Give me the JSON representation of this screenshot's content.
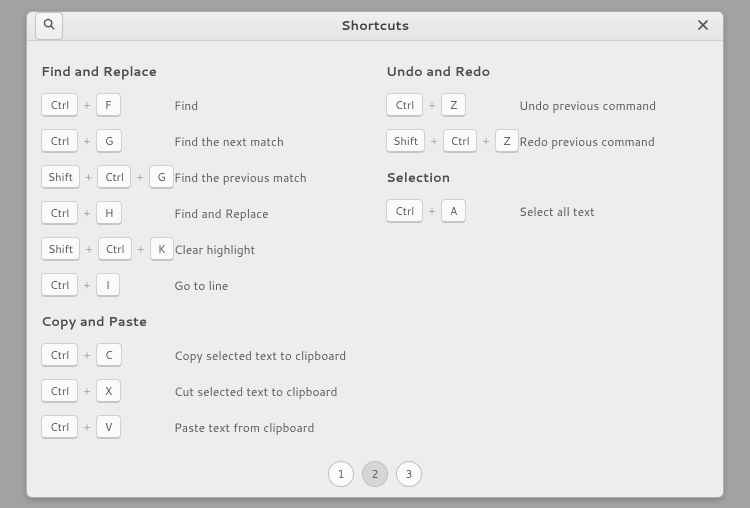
{
  "title": "Shortcuts",
  "plus": "+",
  "left": {
    "sections": [
      {
        "title": "Find and Replace",
        "rows": [
          {
            "keys": [
              "Ctrl",
              "F"
            ],
            "desc": "Find"
          },
          {
            "keys": [
              "Ctrl",
              "G"
            ],
            "desc": "Find the next match"
          },
          {
            "keys": [
              "Shift",
              "Ctrl",
              "G"
            ],
            "desc": "Find the previous match"
          },
          {
            "keys": [
              "Ctrl",
              "H"
            ],
            "desc": "Find and Replace"
          },
          {
            "keys": [
              "Shift",
              "Ctrl",
              "K"
            ],
            "desc": "Clear highlight"
          },
          {
            "keys": [
              "Ctrl",
              "I"
            ],
            "desc": "Go to line"
          }
        ]
      },
      {
        "title": "Copy and Paste",
        "rows": [
          {
            "keys": [
              "Ctrl",
              "C"
            ],
            "desc": "Copy selected text to clipboard"
          },
          {
            "keys": [
              "Ctrl",
              "X"
            ],
            "desc": "Cut selected text to clipboard"
          },
          {
            "keys": [
              "Ctrl",
              "V"
            ],
            "desc": "Paste text from clipboard"
          }
        ]
      }
    ]
  },
  "right": {
    "sections": [
      {
        "title": "Undo and Redo",
        "rows": [
          {
            "keys": [
              "Ctrl",
              "Z"
            ],
            "desc": "Undo previous command"
          },
          {
            "keys": [
              "Shift",
              "Ctrl",
              "Z"
            ],
            "desc": "Redo previous command"
          }
        ]
      },
      {
        "title": "Selection",
        "rows": [
          {
            "keys": [
              "Ctrl",
              "A"
            ],
            "desc": "Select all text"
          }
        ]
      }
    ]
  },
  "pages": {
    "items": [
      "1",
      "2",
      "3"
    ],
    "active": 1
  }
}
